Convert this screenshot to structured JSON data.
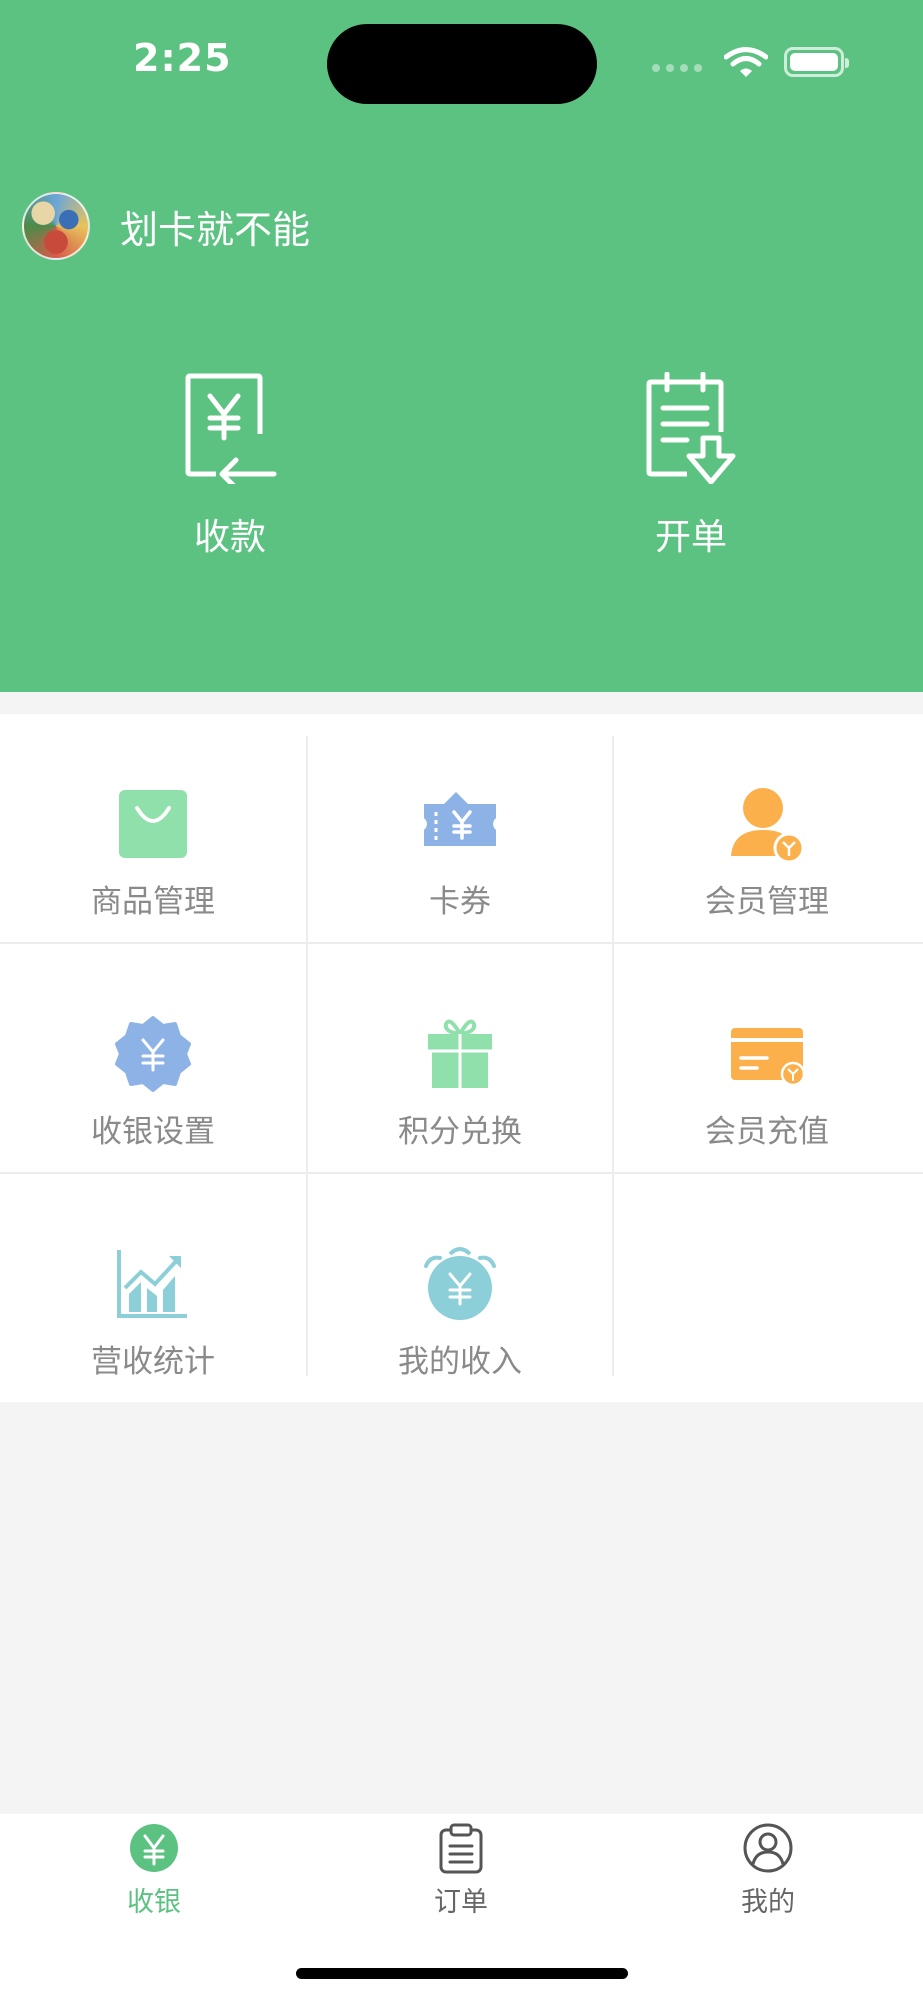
{
  "status_bar": {
    "time": "2:25"
  },
  "user": {
    "name": "划卡就不能"
  },
  "actions": [
    {
      "label": "收款",
      "icon": "receive-payment-icon"
    },
    {
      "label": "开单",
      "icon": "create-order-icon"
    }
  ],
  "grid": [
    {
      "label": "商品管理",
      "icon": "shopping-bag-icon",
      "color": "#8fe0ab"
    },
    {
      "label": "卡券",
      "icon": "coupon-ticket-icon",
      "color": "#8cb2e6"
    },
    {
      "label": "会员管理",
      "icon": "member-icon",
      "color": "#fbb04b"
    },
    {
      "label": "收银设置",
      "icon": "cashier-settings-icon",
      "color": "#8cb2e6"
    },
    {
      "label": "积分兑换",
      "icon": "gift-icon",
      "color": "#8fe0ab"
    },
    {
      "label": "会员充值",
      "icon": "card-recharge-icon",
      "color": "#fbb04b"
    },
    {
      "label": "营收统计",
      "icon": "revenue-chart-icon",
      "color": "#8ccfd9"
    },
    {
      "label": "我的收入",
      "icon": "income-alarm-icon",
      "color": "#8ccfd9"
    }
  ],
  "tabs": [
    {
      "label": "收银",
      "icon": "cashier-tab-icon",
      "active": true
    },
    {
      "label": "订单",
      "icon": "clipboard-tab-icon",
      "active": false
    },
    {
      "label": "我的",
      "icon": "profile-tab-icon",
      "active": false
    }
  ],
  "colors": {
    "primary": "#5cc282",
    "background": "#f4f4f4"
  }
}
